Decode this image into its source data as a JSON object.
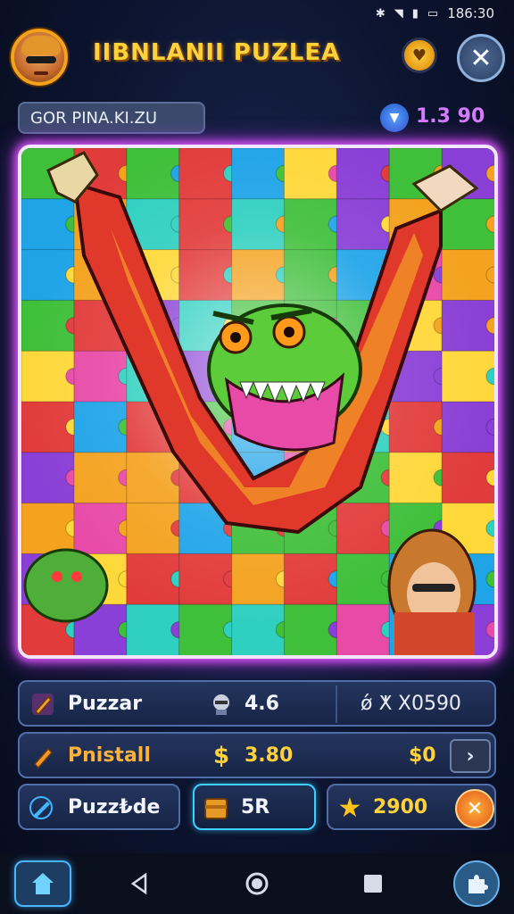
{
  "status_bar": {
    "time": "186:30",
    "icons": [
      "bluetooth-icon",
      "wifi-icon",
      "signal-icon",
      "battery-icon"
    ]
  },
  "header": {
    "title": "IIBNLANII PUZLEA",
    "coin_icon": "coin-icon",
    "close_icon": "close-icon"
  },
  "subbar": {
    "level_label": "GOR PINA.KI.ZU",
    "gem_value": "1.3 90"
  },
  "board": {
    "image": "monster-jigsaw-puzzle"
  },
  "stats": {
    "row1": {
      "label": "Puzzar",
      "value": "4.6",
      "extra": "ǿ ⵅ X0590"
    },
    "row2": {
      "label": "Pnistall",
      "value": "3.80",
      "price": "$0"
    },
    "row3": {
      "label": "Puzz₺de",
      "box_value": "5R",
      "stars": "2900"
    }
  },
  "colors": {
    "title": "#ffd13a",
    "glow": "#e257ff",
    "gem": "#d57bff",
    "accent": "#3fd0ff"
  }
}
